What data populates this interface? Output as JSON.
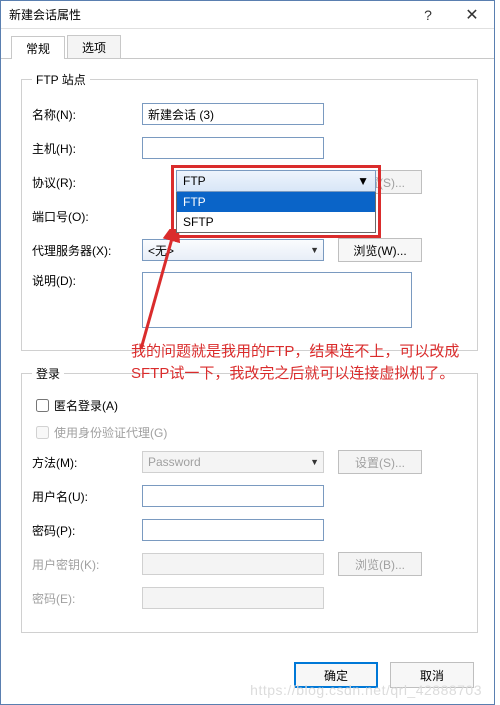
{
  "titlebar": {
    "title": "新建会话属性",
    "help": "?",
    "close": "✕"
  },
  "tabs": {
    "general": "常规",
    "options": "选项"
  },
  "ftp": {
    "legend": "FTP 站点",
    "name_label": "名称(N):",
    "name_value": "新建会话 (3)",
    "host_label": "主机(H):",
    "host_value": "",
    "protocol_label": "协议(R):",
    "protocol_value": "FTP",
    "protocol_options": {
      "ftp": "FTP",
      "sftp": "SFTP"
    },
    "protocol_settings_btn": "设置(S)...",
    "port_label": "端口号(O):",
    "port_value": "",
    "proxy_label": "代理服务器(X):",
    "proxy_value": "<无>",
    "proxy_browse_btn": "浏览(W)...",
    "desc_label": "说明(D):",
    "desc_value": ""
  },
  "login": {
    "legend": "登录",
    "anon_label": "匿名登录(A)",
    "cert_agent_label": "使用身份验证代理(G)",
    "method_label": "方法(M):",
    "method_value": "Password",
    "method_settings_btn": "设置(S)...",
    "user_label": "用户名(U):",
    "user_value": "",
    "pass_label": "密码(P):",
    "pass_value": "",
    "userkey_label": "用户密钥(K):",
    "userkey_value": "",
    "userkey_browse_btn": "浏览(B)...",
    "keypass_label": "密码(E):",
    "keypass_value": ""
  },
  "buttons": {
    "ok": "确定",
    "cancel": "取消"
  },
  "annotation": "我的问题就是我用的FTP，结果连不上，可以改成SFTP试一下，我改完之后就可以连接虚拟机了。",
  "watermark": "https://blog.csdn.net/qrl_42888703"
}
